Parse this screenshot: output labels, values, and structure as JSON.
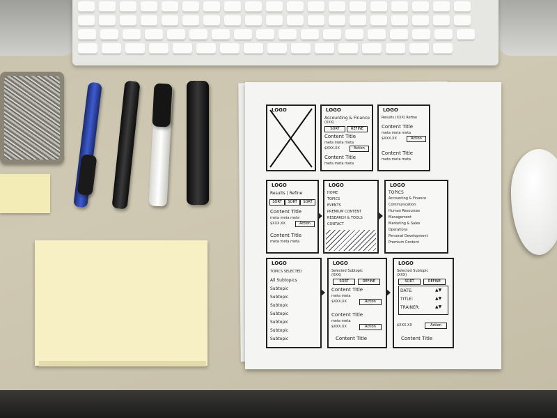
{
  "objects": {
    "keyboard": "keyboard",
    "tin": "paper clip tin",
    "pens": [
      "blue pen",
      "black pen",
      "marker",
      "highlighter"
    ],
    "mouse": "mouse",
    "sticky_pad": "sticky note pad"
  },
  "sketch": {
    "row1": [
      {
        "logo": "LOGO",
        "crossed": true
      },
      {
        "logo": "LOGO",
        "title": "Accounting & Finance",
        "count": "(XXX)",
        "sort": "SORT",
        "refine": "REFINE",
        "content": "Content Title",
        "meta": "meta meta meta",
        "price": "$XXX.XX",
        "action": "Action",
        "content2": "Content Title",
        "meta2": "meta meta meta"
      },
      {
        "logo": "LOGO",
        "title": "Results (XXX) Refine",
        "content": "Content Title",
        "meta": "meta meta meta",
        "price": "$XXX.XX",
        "action": "Action",
        "content2": "Content Title",
        "meta2": "meta meta meta"
      }
    ],
    "row2": [
      {
        "logo": "LOGO",
        "title": "Results | Refine",
        "sort_labels": [
          "SORT",
          "SORT",
          "SORT"
        ],
        "content": "Content Title",
        "meta": "meta meta meta",
        "price": "$XXX.XX",
        "action": "Action",
        "content2": "Content Title",
        "meta2": "meta meta meta"
      },
      {
        "logo": "LOGO",
        "menu": [
          "HOME",
          "TOPICS",
          "EVENTS",
          "PREMIUM CONTENT",
          "RESEARCH & TOOLS",
          "CONTACT"
        ]
      },
      {
        "logo": "LOGO",
        "title": "TOPICS",
        "items": [
          "Accounting & Finance",
          "Communication",
          "Human Resources",
          "Management",
          "Marketing & Sales",
          "Operations",
          "Personal Development",
          "Premium Content"
        ]
      }
    ],
    "row3": [
      {
        "logo": "LOGO",
        "title": "TOPICS SELECTED",
        "items": [
          "All Subtopics",
          "Subtopic",
          "Subtopic",
          "Subtopic",
          "Subtopic",
          "Subtopic",
          "Subtopic",
          "Subtopic"
        ]
      },
      {
        "logo": "LOGO",
        "title": "Selected Subtopic",
        "count": "(XXX)",
        "sort": "SORT",
        "refine": "REFINE",
        "content": "Content Title",
        "meta": "meta meta",
        "price": "$XXX.XX",
        "action": "Action",
        "content2": "Content Title",
        "meta2": "meta meta",
        "price2": "$XXX.XX",
        "action2": "Action",
        "content3": "Content Title"
      },
      {
        "logo": "LOGO",
        "title": "Selected Subtopic",
        "count": "(XXX)",
        "sort": "SORT",
        "refine": "REFINE",
        "filters": [
          "DATE:",
          "TITLE:",
          "TRAINER:"
        ],
        "price": "$XXX.XX",
        "action": "Action",
        "content": "Content Title"
      }
    ]
  }
}
